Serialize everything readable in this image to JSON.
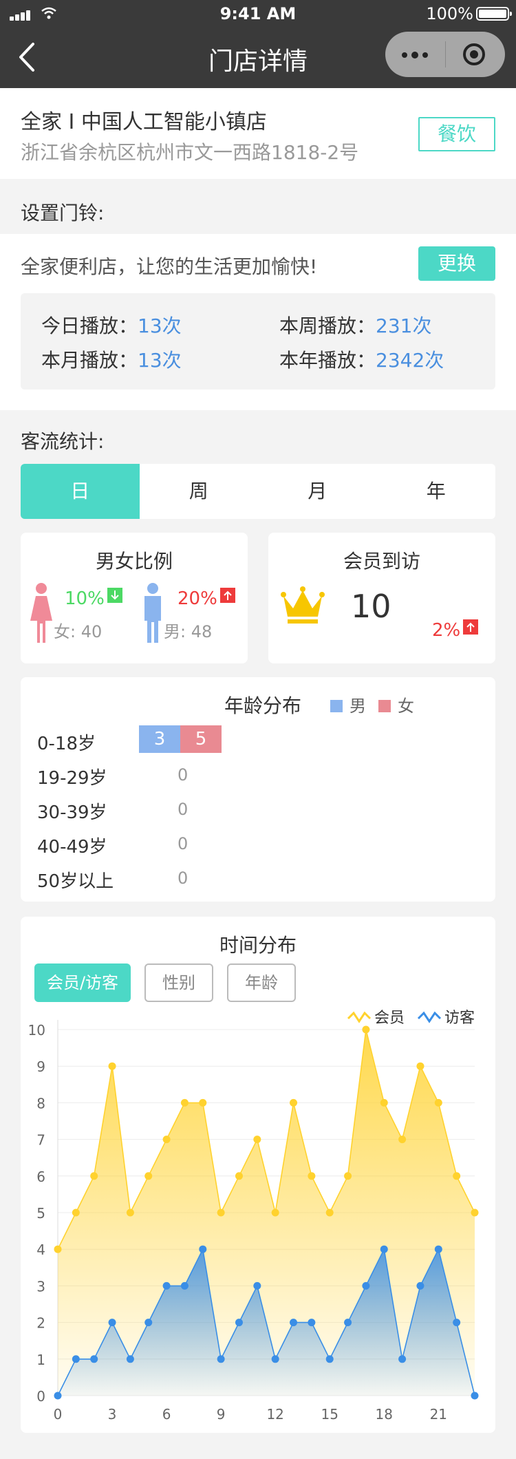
{
  "status_bar": {
    "time": "9:41 AM",
    "battery": "100%"
  },
  "nav": {
    "title": "门店详情"
  },
  "store": {
    "name": "全家 I 中国人工智能小镇店",
    "address": "浙江省余杭区杭州市文一西路1818-2号",
    "category_tag": "餐饮"
  },
  "doorbell": {
    "section_label": "设置门铃:",
    "message": "全家便利店，让您的生活更加愉快!",
    "change_button": "更换",
    "plays": [
      {
        "label": "今日播放：",
        "value": "13次"
      },
      {
        "label": "本周播放：",
        "value": "231次"
      },
      {
        "label": "本月播放：",
        "value": "13次"
      },
      {
        "label": "本年播放：",
        "value": "2342次"
      }
    ]
  },
  "traffic": {
    "section_label": "客流统计:",
    "tabs": [
      "日",
      "周",
      "月",
      "年"
    ],
    "active_tab": "日",
    "gender": {
      "title": "男女比例",
      "female": {
        "pct": "10%",
        "trend": "down",
        "count_label": "女: 40",
        "color": "#f08a98"
      },
      "male": {
        "pct": "20%",
        "trend": "up",
        "count_label": "男: 48",
        "color": "#8ab4ee"
      }
    },
    "member": {
      "title": "会员到访",
      "count": "10",
      "pct": "2%",
      "trend": "up",
      "icon": "crown-icon"
    }
  },
  "age": {
    "title": "年龄分布",
    "legend": [
      {
        "label": "男",
        "color": "#8ab4ee"
      },
      {
        "label": "女",
        "color": "#e98a92"
      }
    ],
    "rows": [
      {
        "label": "0-18岁",
        "male": 3,
        "female": 5
      },
      {
        "label": "19-29岁",
        "value": "0"
      },
      {
        "label": "30-39岁",
        "value": "0"
      },
      {
        "label": "40-49岁",
        "value": "0"
      },
      {
        "label": "50岁以上",
        "value": "0"
      }
    ]
  },
  "time_dist": {
    "title": "时间分布",
    "filters": [
      "会员/访客",
      "性别",
      "年龄"
    ],
    "active_filter": "会员/访客"
  },
  "chart_data": {
    "type": "area",
    "x": [
      0,
      1,
      2,
      3,
      4,
      5,
      6,
      7,
      8,
      9,
      10,
      11,
      12,
      13,
      14,
      15,
      16,
      17,
      18,
      19,
      20,
      21,
      22
    ],
    "x_ticks": [
      "0",
      "3",
      "6",
      "9",
      "12",
      "15",
      "18",
      "21"
    ],
    "ylim": [
      0,
      10
    ],
    "y_ticks": [
      "0",
      "1",
      "2",
      "3",
      "4",
      "5",
      "6",
      "7",
      "8",
      "9",
      "10"
    ],
    "grid": true,
    "legend_position": "top-right",
    "series": [
      {
        "name": "会员",
        "color": "#ffd22e",
        "values": [
          4,
          5,
          6,
          9,
          5,
          6,
          7,
          8,
          8,
          5,
          6,
          7,
          5,
          8,
          6,
          5,
          6,
          10,
          8,
          7,
          9,
          8,
          6,
          5
        ]
      },
      {
        "name": "访客",
        "color": "#3a8ee6",
        "values": [
          0,
          1,
          1,
          2,
          1,
          2,
          3,
          3,
          4,
          1,
          2,
          3,
          1,
          2,
          2,
          1,
          2,
          3,
          4,
          1,
          3,
          4,
          2,
          0
        ]
      }
    ]
  },
  "colors": {
    "accent": "#4cd8c6",
    "link_blue": "#4a8fdf",
    "up_red": "#ee3b3b",
    "down_green": "#4cd964"
  }
}
